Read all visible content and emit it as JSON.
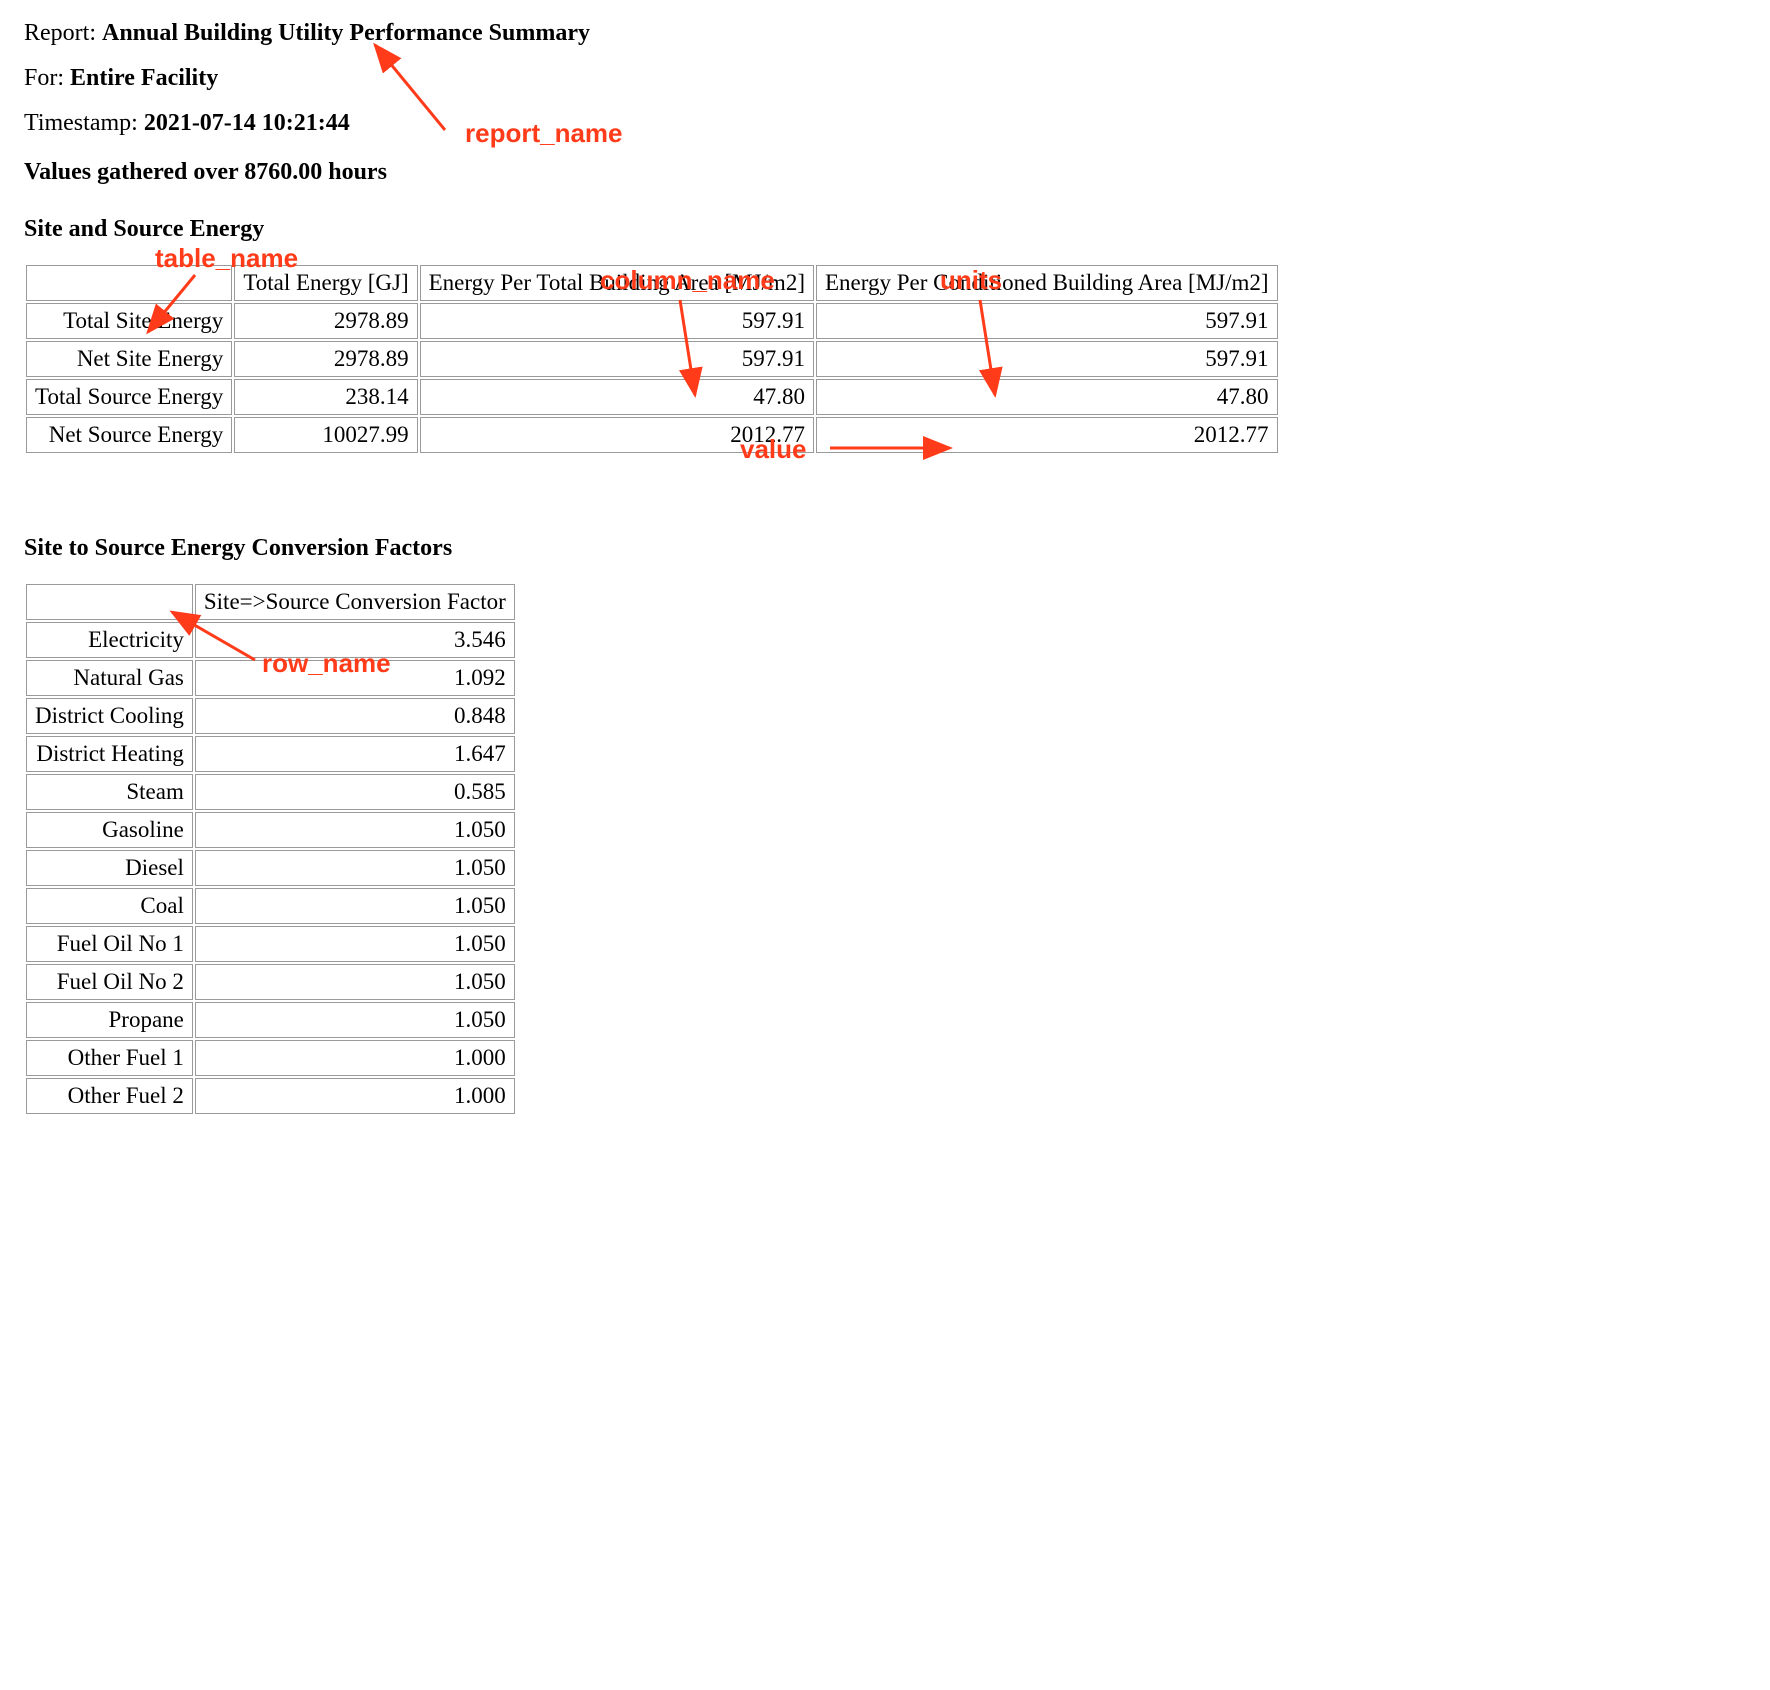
{
  "header": {
    "report_label": "Report: ",
    "report_name": "Annual Building Utility Performance Summary",
    "for_label": "For: ",
    "for_value": "Entire Facility",
    "timestamp_label": "Timestamp: ",
    "timestamp_value": "2021-07-14 10:21:44",
    "hours_line": "Values gathered over 8760.00 hours"
  },
  "table1": {
    "title": "Site and Source Energy",
    "columns": [
      "Total Energy [GJ]",
      "Energy Per Total Building Area [MJ/m2]",
      "Energy Per Conditioned Building Area [MJ/m2]"
    ],
    "rows": [
      {
        "name": "Total Site Energy",
        "values": [
          "2978.89",
          "597.91",
          "597.91"
        ]
      },
      {
        "name": "Net Site Energy",
        "values": [
          "2978.89",
          "597.91",
          "597.91"
        ]
      },
      {
        "name": "Total Source Energy",
        "values": [
          "238.14",
          "47.80",
          "47.80"
        ]
      },
      {
        "name": "Net Source Energy",
        "values": [
          "10027.99",
          "2012.77",
          "2012.77"
        ]
      }
    ]
  },
  "table2": {
    "title": "Site to Source Energy Conversion Factors",
    "columns": [
      "Site=>Source Conversion Factor"
    ],
    "rows": [
      {
        "name": "Electricity",
        "values": [
          "3.546"
        ]
      },
      {
        "name": "Natural Gas",
        "values": [
          "1.092"
        ]
      },
      {
        "name": "District Cooling",
        "values": [
          "0.848"
        ]
      },
      {
        "name": "District Heating",
        "values": [
          "1.647"
        ]
      },
      {
        "name": "Steam",
        "values": [
          "0.585"
        ]
      },
      {
        "name": "Gasoline",
        "values": [
          "1.050"
        ]
      },
      {
        "name": "Diesel",
        "values": [
          "1.050"
        ]
      },
      {
        "name": "Coal",
        "values": [
          "1.050"
        ]
      },
      {
        "name": "Fuel Oil No 1",
        "values": [
          "1.050"
        ]
      },
      {
        "name": "Fuel Oil No 2",
        "values": [
          "1.050"
        ]
      },
      {
        "name": "Propane",
        "values": [
          "1.050"
        ]
      },
      {
        "name": "Other Fuel 1",
        "values": [
          "1.000"
        ]
      },
      {
        "name": "Other Fuel 2",
        "values": [
          "1.000"
        ]
      }
    ]
  },
  "annotations": {
    "report_name": "report_name",
    "table_name": "table_name",
    "column_name": "column_name",
    "units": "units",
    "value": "value",
    "row_name": "row_name"
  }
}
